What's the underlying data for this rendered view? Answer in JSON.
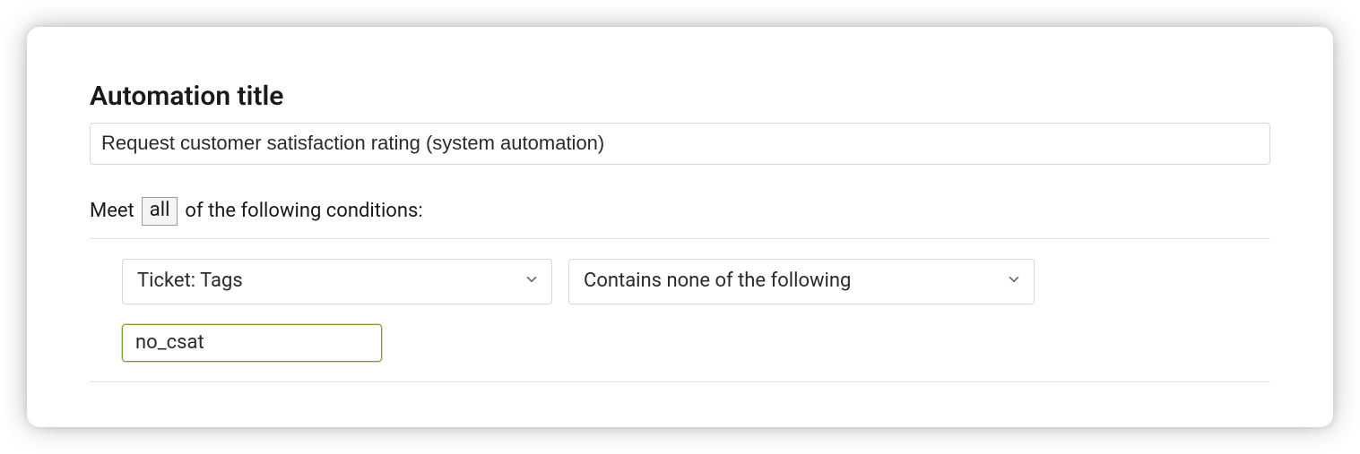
{
  "title": {
    "label": "Automation title",
    "value": "Request customer satisfaction rating (system automation)"
  },
  "conditions": {
    "prefix": "Meet",
    "match_mode": "all",
    "suffix": "of the following conditions:",
    "rows": [
      {
        "field": "Ticket: Tags",
        "operator": "Contains none of the following",
        "value": "no_csat"
      }
    ]
  }
}
